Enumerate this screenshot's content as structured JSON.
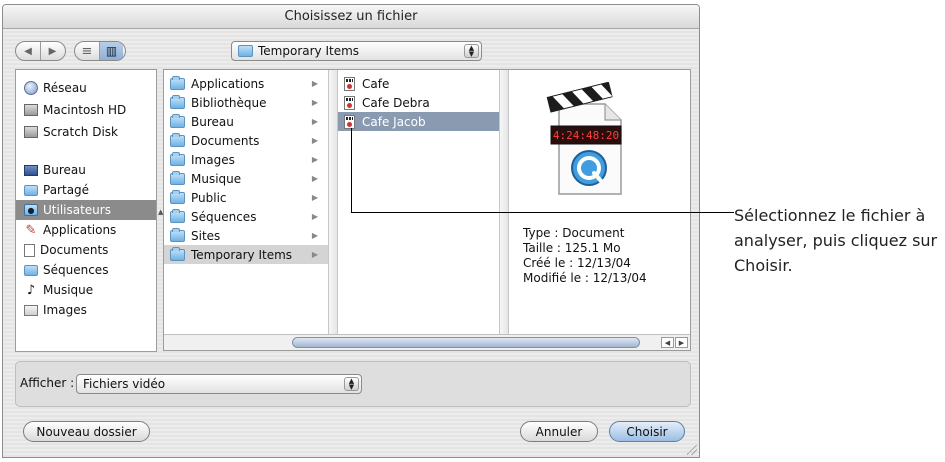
{
  "window": {
    "title": "Choisissez un fichier"
  },
  "toolbar": {
    "back_label": "◀",
    "forward_label": "▶",
    "list_view_label": "≡",
    "column_view_label": "▥",
    "location": "Temporary Items"
  },
  "sidebar": {
    "items": [
      {
        "label": "Réseau",
        "icon": "network-icon"
      },
      {
        "label": "Macintosh HD",
        "icon": "hard-disk-icon"
      },
      {
        "label": "Scratch Disk",
        "icon": "hard-disk-icon"
      },
      {
        "label": "Bureau",
        "icon": "desktop-icon"
      },
      {
        "label": "Partagé",
        "icon": "folder-icon"
      },
      {
        "label": "Utilisateurs",
        "icon": "users-icon"
      },
      {
        "label": "Applications",
        "icon": "applications-icon"
      },
      {
        "label": "Documents",
        "icon": "documents-icon"
      },
      {
        "label": "Séquences",
        "icon": "folder-icon"
      },
      {
        "label": "Musique",
        "icon": "music-icon"
      },
      {
        "label": "Images",
        "icon": "images-icon"
      }
    ]
  },
  "browser": {
    "column1": [
      "Applications",
      "Bibliothèque",
      "Bureau",
      "Documents",
      "Images",
      "Musique",
      "Public",
      "Séquences",
      "Sites",
      "Temporary Items"
    ],
    "column2": [
      "Cafe",
      "Cafe Debra",
      "Cafe Jacob"
    ],
    "preview": {
      "timecode": "4:24:48:20",
      "type": "Type : Document",
      "size": "Taille : 125.1 Mo",
      "created": "Créé le : 12/13/04",
      "modified": "Modifié le : 12/13/04"
    }
  },
  "filter": {
    "label": "Afficher :",
    "value": "Fichiers vidéo"
  },
  "buttons": {
    "new_folder": "Nouveau dossier",
    "cancel": "Annuler",
    "choose": "Choisir"
  },
  "callout": {
    "text": "Sélectionnez le fichier à analyser, puis cliquez sur Choisir."
  }
}
